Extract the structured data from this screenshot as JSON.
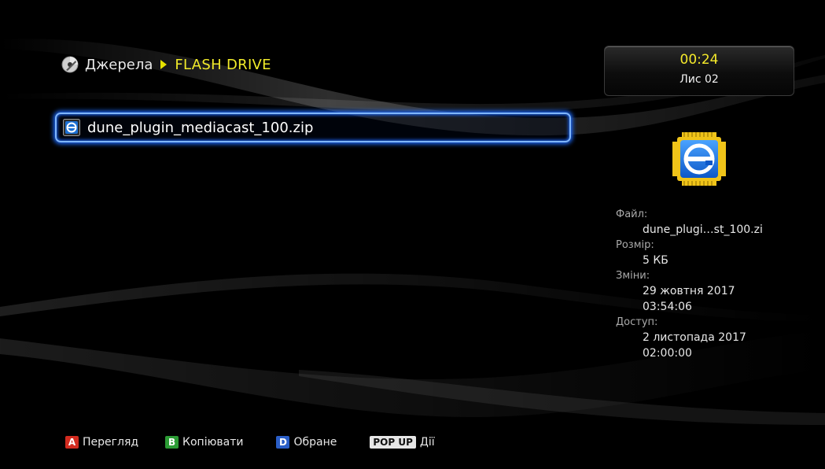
{
  "breadcrumb": {
    "root": "Джерела",
    "current": "FLASH DRIVE"
  },
  "clock": {
    "time": "00:24",
    "page": "Лис 02"
  },
  "file_list": [
    {
      "name": "dune_plugin_mediacast_100.zip",
      "icon": "plugin-chip-icon",
      "selected": true
    }
  ],
  "info": {
    "file_label": "Файл:",
    "file_value": "dune_plugi…st_100.zi",
    "size_label": "Розмір:",
    "size_value": "5 КБ",
    "modified_label": "Зміни:",
    "modified_date": "29 жовтня 2017",
    "modified_time": "03:54:06",
    "access_label": "Доступ:",
    "access_date": "2 листопада 2017",
    "access_time": "02:00:00"
  },
  "footer": {
    "a_key": "A",
    "a_label": "Перегляд",
    "b_key": "B",
    "b_label": "Копіювати",
    "d_key": "D",
    "d_label": "Обране",
    "popup_key": "POP UP",
    "popup_label": "Дії"
  },
  "colors": {
    "accent_yellow": "#f2ec2a",
    "selection_blue": "#1d6bff",
    "key_red": "#d22b1f",
    "key_green": "#2b9b34",
    "key_blue": "#2a5ec7"
  }
}
